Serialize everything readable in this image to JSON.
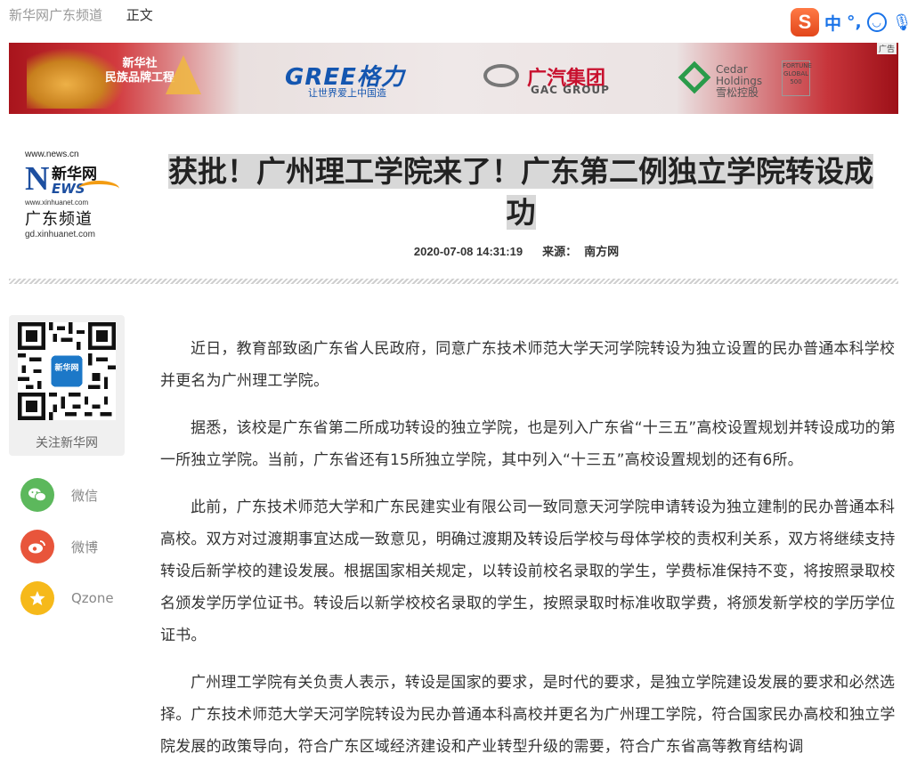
{
  "breadcrumb": {
    "site": "新华网广东频道",
    "current": "正文"
  },
  "ime": {
    "mode": "中",
    "punct": "°,"
  },
  "banner": {
    "ad_tag": "广告",
    "xinhuashe_line1": "新华社",
    "xinhuashe_line2": "民族品牌工程",
    "gree_name": "GREE格力",
    "gree_slogan": "让世界爱上中国造",
    "gac_name": "广汽集团",
    "gac_sub": "GAC GROUP",
    "cedar_line1": "Cedar",
    "cedar_line2": "Holdings",
    "cedar_line3": "雪松控股",
    "fortune_text": "FORTUNE GLOBAL 500"
  },
  "logo": {
    "url_top": "www.news.cn",
    "n_letter": "N",
    "xinhuawang": "新华网",
    "ews": "EWS",
    "url_mid": "www.xinhuanet.com",
    "channel": "广东频道",
    "url_bottom": "gd.xinhuanet.com"
  },
  "article": {
    "title": "获批！广州理工学院来了！广东第二例独立学院转设成功",
    "datetime": "2020-07-08 14:31:19",
    "source_label": "来源：",
    "source": "南方网",
    "paragraphs": [
      "近日，教育部致函广东省人民政府，同意广东技术师范大学天河学院转设为独立设置的民办普通本科学校并更名为广州理工学院。",
      "据悉，该校是广东省第二所成功转设的独立学院，也是列入广东省“十三五”高校设置规划并转设成功的第一所独立学院。当前，广东省还有15所独立学院，其中列入“十三五”高校设置规划的还有6所。",
      "此前，广东技术师范大学和广东民建实业有限公司一致同意天河学院申请转设为独立建制的民办普通本科高校。双方对过渡期事宜达成一致意见，明确过渡期及转设后学校与母体学校的责权利关系，双方将继续支持转设后新学校的建设发展。根据国家相关规定，以转设前校名录取的学生，学费标准保持不变，将按照录取校名颁发学历学位证书。转设后以新学校校名录取的学生，按照录取时标准收取学费，将颁发新学校的学历学位证书。",
      "广州理工学院有关负责人表示，转设是国家的要求，是时代的要求，是独立学院建设发展的要求和必然选择。广东技术师范大学天河学院转设为民办普通本科高校并更名为广州理工学院，符合国家民办高校和独立学院发展的政策导向，符合广东区域经济建设和产业转型升级的需要，符合广东省高等教育结构调"
    ]
  },
  "share": {
    "qr_label": "关注新华网",
    "qr_badge": "新华网",
    "items": [
      {
        "label": "微信",
        "icon": "wechat-icon"
      },
      {
        "label": "微博",
        "icon": "weibo-icon"
      },
      {
        "label": "Qzone",
        "icon": "qzone-icon"
      }
    ]
  }
}
